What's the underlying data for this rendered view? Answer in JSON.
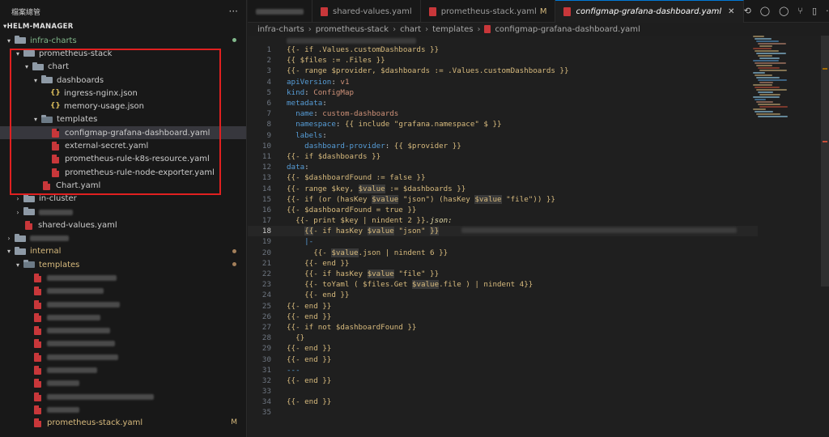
{
  "sidebar": {
    "title": "檔案總管",
    "root": "HELM-MANAGER",
    "items": [
      {
        "depth": 0,
        "kind": "folder",
        "open": true,
        "label": "infra-charts",
        "color": "green",
        "badge": "dot-green"
      },
      {
        "depth": 1,
        "kind": "folder",
        "open": true,
        "label": "prometheus-stack"
      },
      {
        "depth": 2,
        "kind": "folder",
        "open": true,
        "label": "chart"
      },
      {
        "depth": 3,
        "kind": "folder",
        "open": true,
        "label": "dashboards"
      },
      {
        "depth": 4,
        "kind": "json",
        "label": "ingress-nginx.json"
      },
      {
        "depth": 4,
        "kind": "json",
        "label": "memory-usage.json"
      },
      {
        "depth": 3,
        "kind": "folder-special",
        "open": true,
        "label": "templates"
      },
      {
        "depth": 4,
        "kind": "yaml",
        "label": "configmap-grafana-dashboard.yaml",
        "selected": true
      },
      {
        "depth": 4,
        "kind": "yaml",
        "label": "external-secret.yaml"
      },
      {
        "depth": 4,
        "kind": "yaml",
        "label": "prometheus-rule-k8s-resource.yaml"
      },
      {
        "depth": 4,
        "kind": "yaml",
        "label": "prometheus-rule-node-exporter.yaml"
      },
      {
        "depth": 3,
        "kind": "yaml",
        "label": "Chart.yaml"
      },
      {
        "depth": 1,
        "kind": "folder",
        "open": false,
        "label": "in-cluster"
      },
      {
        "depth": 1,
        "kind": "folder",
        "open": false,
        "blur": 42
      },
      {
        "depth": 1,
        "kind": "yaml",
        "label": "shared-values.yaml"
      },
      {
        "depth": 0,
        "kind": "folder",
        "open": false,
        "blur": 48
      },
      {
        "depth": 0,
        "kind": "folder",
        "open": true,
        "label": "internal",
        "color": "yellow",
        "badge": "dot-yellow"
      },
      {
        "depth": 1,
        "kind": "folder-special",
        "open": true,
        "label": "templates",
        "color": "yellow",
        "badge": "dot-yellow"
      },
      {
        "depth": 2,
        "kind": "yaml",
        "blur": 86
      },
      {
        "depth": 2,
        "kind": "yaml",
        "blur": 70
      },
      {
        "depth": 2,
        "kind": "yaml",
        "blur": 90
      },
      {
        "depth": 2,
        "kind": "yaml",
        "blur": 66
      },
      {
        "depth": 2,
        "kind": "yaml",
        "blur": 78
      },
      {
        "depth": 2,
        "kind": "yaml",
        "blur": 84
      },
      {
        "depth": 2,
        "kind": "yaml",
        "blur": 88
      },
      {
        "depth": 2,
        "kind": "yaml",
        "blur": 62
      },
      {
        "depth": 2,
        "kind": "yaml",
        "blur": 40
      },
      {
        "depth": 2,
        "kind": "yaml",
        "blur": 132
      },
      {
        "depth": 2,
        "kind": "yaml",
        "blur": 40
      },
      {
        "depth": 2,
        "kind": "yaml",
        "label": "prometheus-stack.yaml",
        "color": "yellow",
        "badge": "M"
      }
    ]
  },
  "tabs": [
    {
      "blur": true
    },
    {
      "label": "shared-values.yaml"
    },
    {
      "label": "prometheus-stack.yaml",
      "modified": "M"
    },
    {
      "label": "configmap-grafana-dashboard.yaml",
      "active": true,
      "close": "✕"
    }
  ],
  "breadcrumb": [
    "infra-charts",
    "prometheus-stack",
    "chart",
    "templates",
    "configmap-grafana-dashboard.yaml"
  ],
  "editor": {
    "current_line": 18,
    "lines": [
      [
        [
          "k",
          "{{- if .Values.customDashboards }}"
        ]
      ],
      [
        [
          "k",
          "{{ $files := .Files }}"
        ]
      ],
      [
        [
          "k",
          "{{- range $provider, $dashboards := .Values.customDashboards }}"
        ]
      ],
      [
        [
          "y",
          "apiVersion"
        ],
        [
          "w",
          ": "
        ],
        [
          "s",
          "v1"
        ]
      ],
      [
        [
          "y",
          "kind"
        ],
        [
          "w",
          ": "
        ],
        [
          "s",
          "ConfigMap"
        ]
      ],
      [
        [
          "y",
          "metadata"
        ],
        [
          "w",
          ":"
        ]
      ],
      [
        [
          "w",
          "  "
        ],
        [
          "y",
          "name"
        ],
        [
          "w",
          ": "
        ],
        [
          "s",
          "custom-dashboards"
        ]
      ],
      [
        [
          "w",
          "  "
        ],
        [
          "y",
          "namespace"
        ],
        [
          "w",
          ": "
        ],
        [
          "k",
          "{{ include \"grafana.namespace\" $ }}"
        ]
      ],
      [
        [
          "w",
          "  "
        ],
        [
          "y",
          "labels"
        ],
        [
          "w",
          ":"
        ]
      ],
      [
        [
          "w",
          "    "
        ],
        [
          "y",
          "dashboard-provider"
        ],
        [
          "w",
          ": "
        ],
        [
          "k",
          "{{ $provider }}"
        ]
      ],
      [
        [
          "k",
          "{{- if $dashboards }}"
        ]
      ],
      [
        [
          "y",
          "data"
        ],
        [
          "w",
          ":"
        ]
      ],
      [
        [
          "k",
          "{{- $dashboardFound := false }}"
        ]
      ],
      [
        [
          "k",
          "{{- range $key, "
        ],
        [
          "kh",
          "$value"
        ],
        [
          "k",
          " := $dashboards }}"
        ]
      ],
      [
        [
          "k",
          "{{- if (or (hasKey "
        ],
        [
          "kh",
          "$value"
        ],
        [
          "k",
          " \"json\") (hasKey "
        ],
        [
          "kh",
          "$value"
        ],
        [
          "k",
          " \"file\")) }}"
        ]
      ],
      [
        [
          "k",
          "{{- $dashboardFound = true }}"
        ]
      ],
      [
        [
          "w",
          "  "
        ],
        [
          "k",
          "{{- print $key | nindent 2 }}"
        ],
        [
          "i",
          ".json:"
        ]
      ],
      [
        [
          "w",
          "    "
        ],
        [
          "kh",
          "{{"
        ],
        [
          "k",
          "- if hasKey "
        ],
        [
          "kh",
          "$value"
        ],
        [
          "k",
          " \"json\" "
        ],
        [
          "kh",
          "}}"
        ],
        [
          "blur",
          ""
        ]
      ],
      [
        [
          "w",
          "    "
        ],
        [
          "y",
          "|-"
        ]
      ],
      [
        [
          "w",
          "      "
        ],
        [
          "k",
          "{{- "
        ],
        [
          "kh",
          "$value"
        ],
        [
          "k",
          ".json | nindent 6 }}"
        ]
      ],
      [
        [
          "w",
          "    "
        ],
        [
          "k",
          "{{- end }}"
        ]
      ],
      [
        [
          "w",
          "    "
        ],
        [
          "k",
          "{{- if hasKey "
        ],
        [
          "kh",
          "$value"
        ],
        [
          "k",
          " \"file\" }}"
        ]
      ],
      [
        [
          "w",
          "    "
        ],
        [
          "k",
          "{{- toYaml ( $files.Get "
        ],
        [
          "kh",
          "$value"
        ],
        [
          "k",
          ".file ) | nindent 4}}"
        ]
      ],
      [
        [
          "w",
          "    "
        ],
        [
          "k",
          "{{- end }}"
        ]
      ],
      [
        [
          "k",
          "{{- end }}"
        ]
      ],
      [
        [
          "k",
          "{{- end }}"
        ]
      ],
      [
        [
          "k",
          "{{- if not $dashboardFound }}"
        ]
      ],
      [
        [
          "w",
          "  "
        ],
        [
          "k",
          "{}"
        ]
      ],
      [
        [
          "k",
          "{{- end }}"
        ]
      ],
      [
        [
          "k",
          "{{- end }}"
        ]
      ],
      [
        [
          "y",
          "---"
        ]
      ],
      [
        [
          "k",
          "{{- end }}"
        ]
      ],
      [],
      [
        [
          "k",
          "{{- end }}"
        ]
      ],
      []
    ]
  },
  "colors": {
    "accent": "#0078d4",
    "yaml_red": "#c8373a",
    "git_green": "#81b88b",
    "git_modified": "#d7ba7d",
    "highlight_box": "#e02020"
  },
  "icons": [
    "more-icon",
    "folder-icon",
    "json-icon",
    "yaml-icon",
    "chevron-icon",
    "compare-icon",
    "split-icon"
  ]
}
